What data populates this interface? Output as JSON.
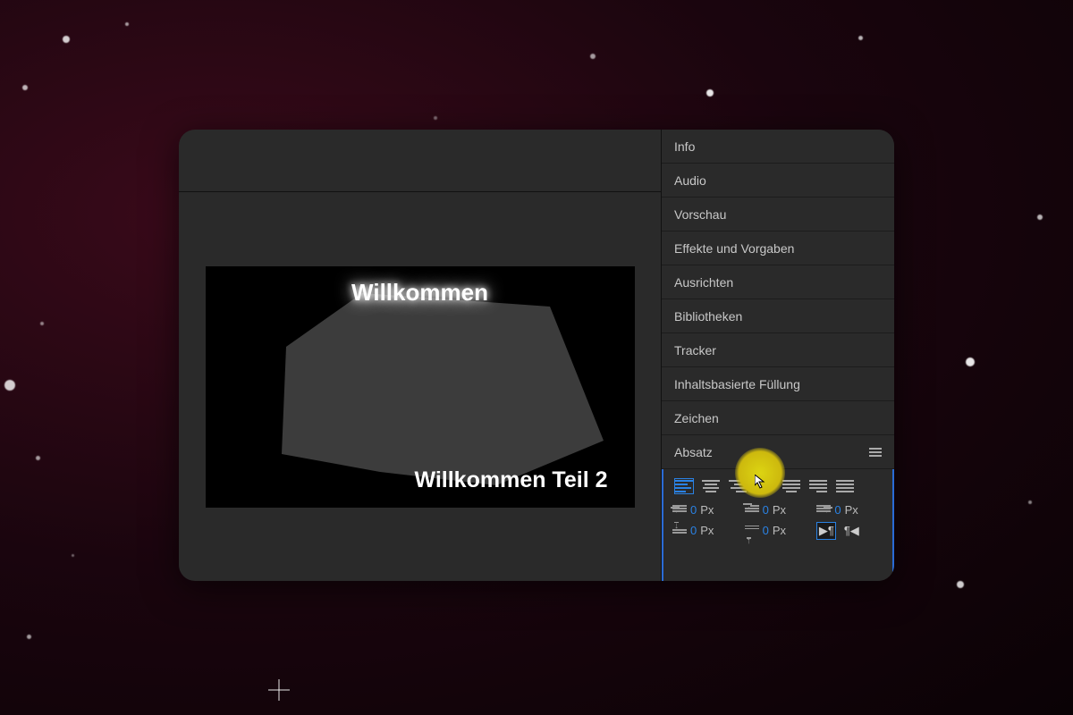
{
  "composition": {
    "title": "Willkommen",
    "subtitle": "Willkommen Teil 2"
  },
  "panels": [
    "Info",
    "Audio",
    "Vorschau",
    "Effekte und Vorgaben",
    "Ausrichten",
    "Bibliotheken",
    "Tracker",
    "Inhaltsbasierte Füllung",
    "Zeichen"
  ],
  "paragraph": {
    "title": "Absatz",
    "indent_left": {
      "value": "0",
      "unit": "Px"
    },
    "indent_right": {
      "value": "0",
      "unit": "Px"
    },
    "indent_first": {
      "value": "0",
      "unit": "Px"
    },
    "space_before": {
      "value": "0",
      "unit": "Px"
    },
    "space_after": {
      "value": "0",
      "unit": "Px"
    }
  }
}
